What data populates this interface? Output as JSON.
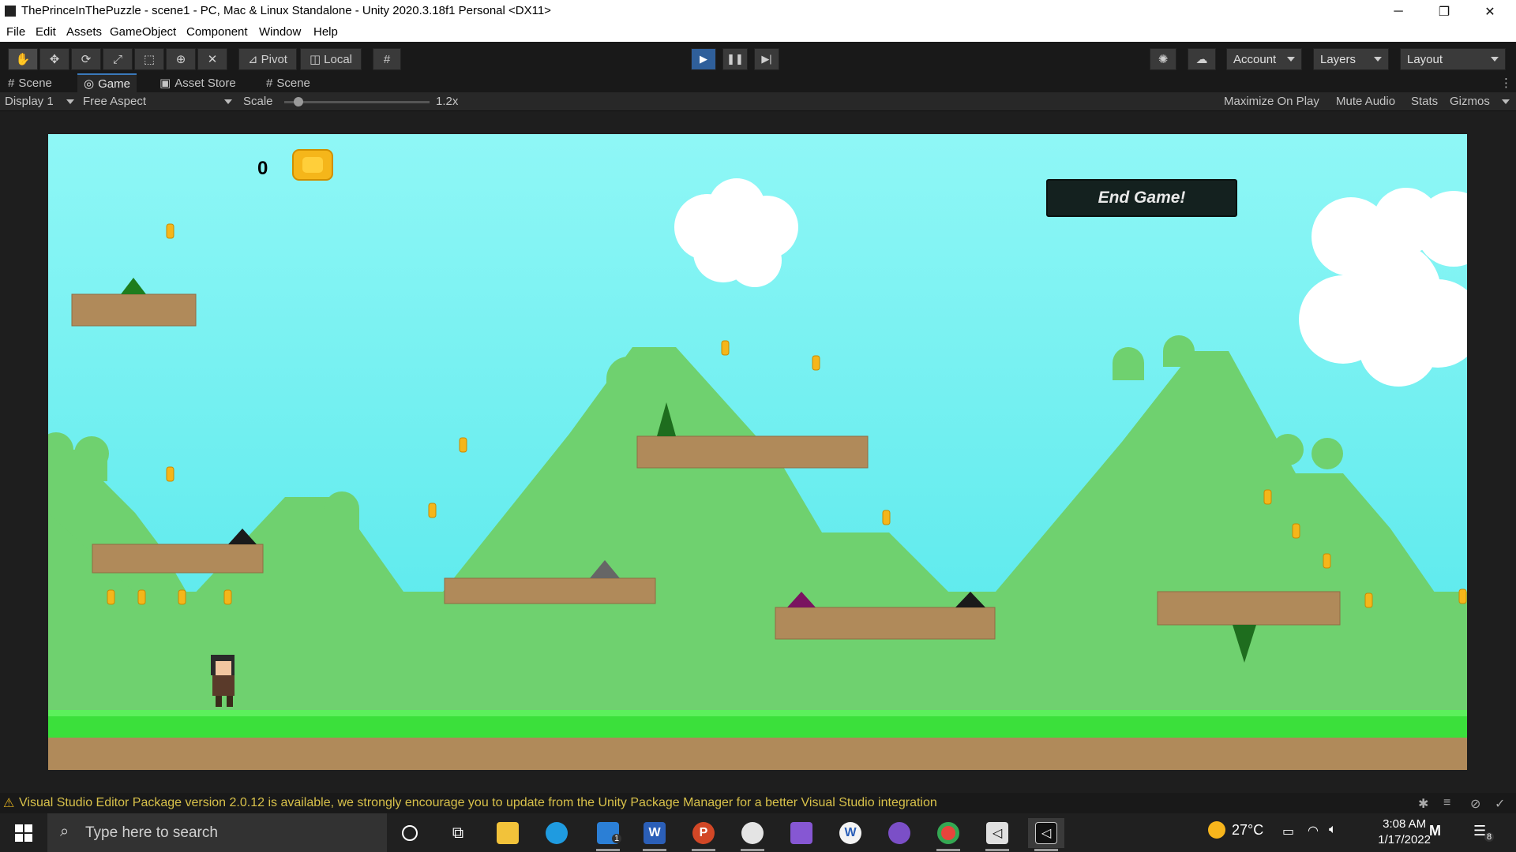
{
  "window": {
    "title": "ThePrinceInThePuzzle - scene1 - PC, Mac & Linux Standalone - Unity 2020.3.18f1 Personal <DX11>",
    "minimize": "─",
    "restore": "❐",
    "close": "✕"
  },
  "menu": [
    "File",
    "Edit",
    "Assets",
    "GameObject",
    "Component",
    "Window",
    "Help"
  ],
  "toolbar": {
    "pivot_label": "Pivot",
    "local_label": "Local",
    "account_label": "Account",
    "layers_label": "Layers",
    "layout_label": "Layout",
    "play_state": "playing"
  },
  "tabs": [
    {
      "label": "Scene",
      "icon": "grid-icon"
    },
    {
      "label": "Game",
      "icon": "gamepad-icon",
      "selected": true
    },
    {
      "label": "Asset Store",
      "icon": "bag-icon"
    },
    {
      "label": "Scene",
      "icon": "grid-icon"
    }
  ],
  "gamebar": {
    "display": "Display 1",
    "aspect": "Free Aspect",
    "scale_label": "Scale",
    "scale_value": "1.2x",
    "maximize": "Maximize On Play",
    "mute": "Mute Audio",
    "stats": "Stats",
    "gizmos": "Gizmos"
  },
  "game": {
    "score": "0",
    "end_button": "End Game!",
    "colors": {
      "sky_top": "#8ff7f6",
      "sky_bottom": "#4fe6ea",
      "hill": "#6fd16f",
      "grass": "#3be03b",
      "dirt": "#b08a5a",
      "coin": "#f5b61a"
    }
  },
  "console": {
    "message": "Visual Studio Editor Package version 2.0.12 is available, we strongly encourage you to update from the Unity Package Manager for a better Visual Studio integration"
  },
  "taskbar": {
    "search_placeholder": "Type here to search",
    "temperature": "27°C",
    "time": "3:08 AM",
    "date": "1/17/2022",
    "mail_badge": "1",
    "notif_badge": "8",
    "apps": [
      "cortana-icon",
      "task-view-icon",
      "file-explorer-icon",
      "edge-icon",
      "mail-icon",
      "word-icon",
      "powerpoint-icon",
      "paint-icon",
      "visual-studio-icon",
      "wordapp-icon",
      "github-icon",
      "chrome-icon",
      "unity-hub-icon",
      "unity-icon"
    ]
  }
}
